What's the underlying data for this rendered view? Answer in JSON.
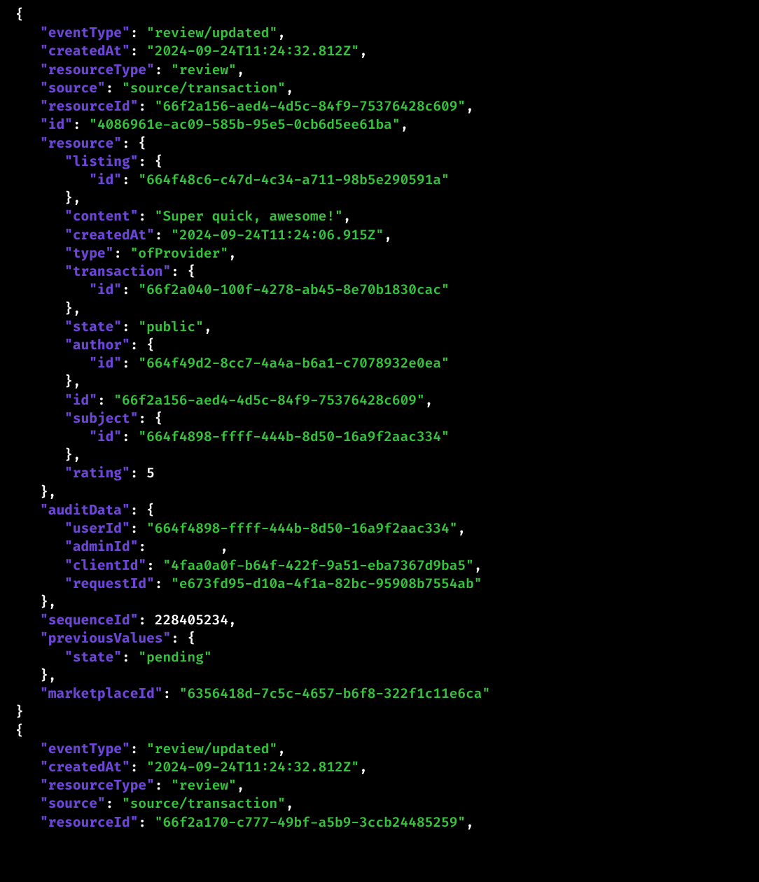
{
  "indentUnit": "   ",
  "display": [
    {
      "eventType": "review/updated",
      "createdAt": "2024-09-24T11:24:32.812Z",
      "resourceType": "review",
      "source": "source/transaction",
      "resourceId": "66f2a156-aed4-4d5c-84f9-75376428c609",
      "id": "4086961e-ac09-585b-95e5-0cb6d5ee61ba",
      "resource": {
        "listing": {
          "id": "664f48c6-c47d-4c34-a711-98b5e290591a"
        },
        "content": "Super quick, awesome!",
        "createdAt": "2024-09-24T11:24:06.915Z",
        "type": "ofProvider",
        "transaction": {
          "id": "66f2a040-100f-4278-ab45-8e70b1830cac"
        },
        "state": "public",
        "author": {
          "id": "664f49d2-8cc7-4a4a-b6a1-c7078932e0ea"
        },
        "id": "66f2a156-aed4-4d5c-84f9-75376428c609",
        "subject": {
          "id": "664f4898-ffff-444b-8d50-16a9f2aac334"
        },
        "rating": 5
      },
      "auditData": {
        "userId": "664f4898-ffff-444b-8d50-16a9f2aac334",
        "adminId": null,
        "clientId": "4faa0a0f-b64f-422f-9a51-eba7367d9ba5",
        "requestId": "e673fd95-d10a-4f1a-82bc-95908b7554ab"
      },
      "sequenceId": 228405234,
      "previousValues": {
        "state": "pending"
      },
      "marketplaceId": "6356418d-7c5c-4657-b6f8-322f1c11e6ca"
    },
    {
      "eventType": "review/updated",
      "createdAt": "2024-09-24T11:24:32.812Z",
      "resourceType": "review",
      "source": "source/transaction",
      "resourceId": "66f2a170-c777-49bf-a5b9-3ccb24485259"
    }
  ],
  "secondObjectTruncatedAfterKeys": [
    "eventType",
    "createdAt",
    "resourceType",
    "source",
    "resourceId"
  ]
}
